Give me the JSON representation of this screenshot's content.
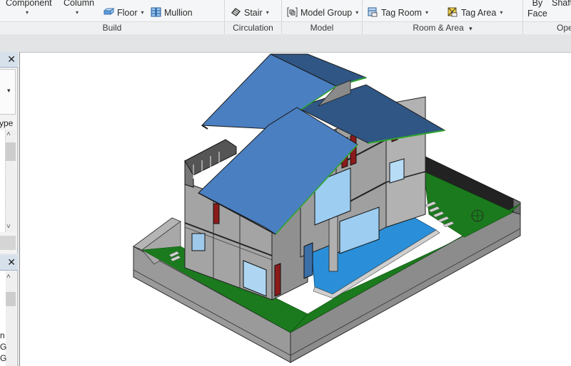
{
  "ribbon": {
    "panels": {
      "build": {
        "title": "Build",
        "component_label": "Component",
        "column_label": "Column",
        "floor_label": "Floor",
        "mullion_label": "Mullion"
      },
      "circulation": {
        "title": "Circulation",
        "stair_label": "Stair"
      },
      "model": {
        "title": "Model",
        "model_group_label": "Model  Group"
      },
      "room_area": {
        "title": "Room & Area",
        "tag_room_label": "Tag  Room",
        "tag_area_label": "Tag  Area"
      },
      "opening": {
        "title": "Ope",
        "by_face_line1": "By",
        "by_face_line2": "Face",
        "shaft_label": "Shaft"
      }
    },
    "caret_glyph": "▾"
  },
  "left_panels": {
    "properties": {
      "close_glyph": "✕",
      "type_label_fragment": "ype",
      "dropdown_glyph": "▾",
      "scroll_up": "˄",
      "scroll_down": "˅"
    },
    "project_browser": {
      "close_glyph": "✕",
      "scroll_up": "˄",
      "items": [
        "n",
        "G",
        "G"
      ]
    }
  },
  "viewport": {
    "view": "3D isometric model of house",
    "colors": {
      "roof_light": "#4a7fc1",
      "roof_dark": "#2f5684",
      "wall": "#a9a9a9",
      "lawn": "#1c7a1c",
      "pool": "#2b8fd6",
      "fence": "#8f8f8f"
    }
  }
}
